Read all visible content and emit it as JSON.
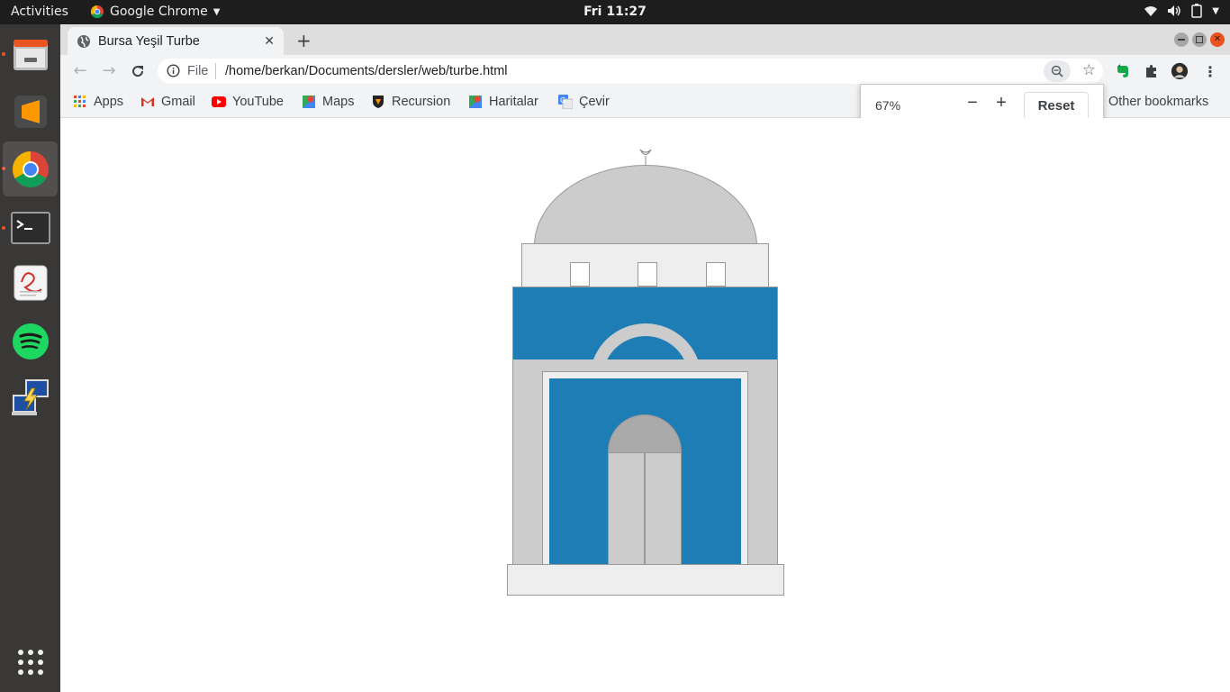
{
  "topbar": {
    "activities": "Activities",
    "app_name": "Google Chrome",
    "clock": "Fri 11:27"
  },
  "dock": {
    "items": [
      "files-icon",
      "sublime-text-icon",
      "chrome-icon",
      "terminal-icon",
      "document-viewer-icon",
      "spotify-icon",
      "remote-desktop-icon",
      "show-apps-icon"
    ]
  },
  "browser": {
    "tab_title": "Bursa Yeşil Turbe",
    "scheme_label": "File",
    "url": "/home/berkan/Documents/dersler/web/turbe.html",
    "bookmarks": [
      "Apps",
      "Gmail",
      "YouTube",
      "Maps",
      "Recursion",
      "Haritalar",
      "Çevir"
    ],
    "other_bookmarks": "Other bookmarks"
  },
  "zoom_popup": {
    "level": "67%",
    "reset_label": "Reset"
  },
  "colors": {
    "accent": "#e95420",
    "tile_blue": "#1e7db5",
    "stone_gray": "#cccccc"
  }
}
